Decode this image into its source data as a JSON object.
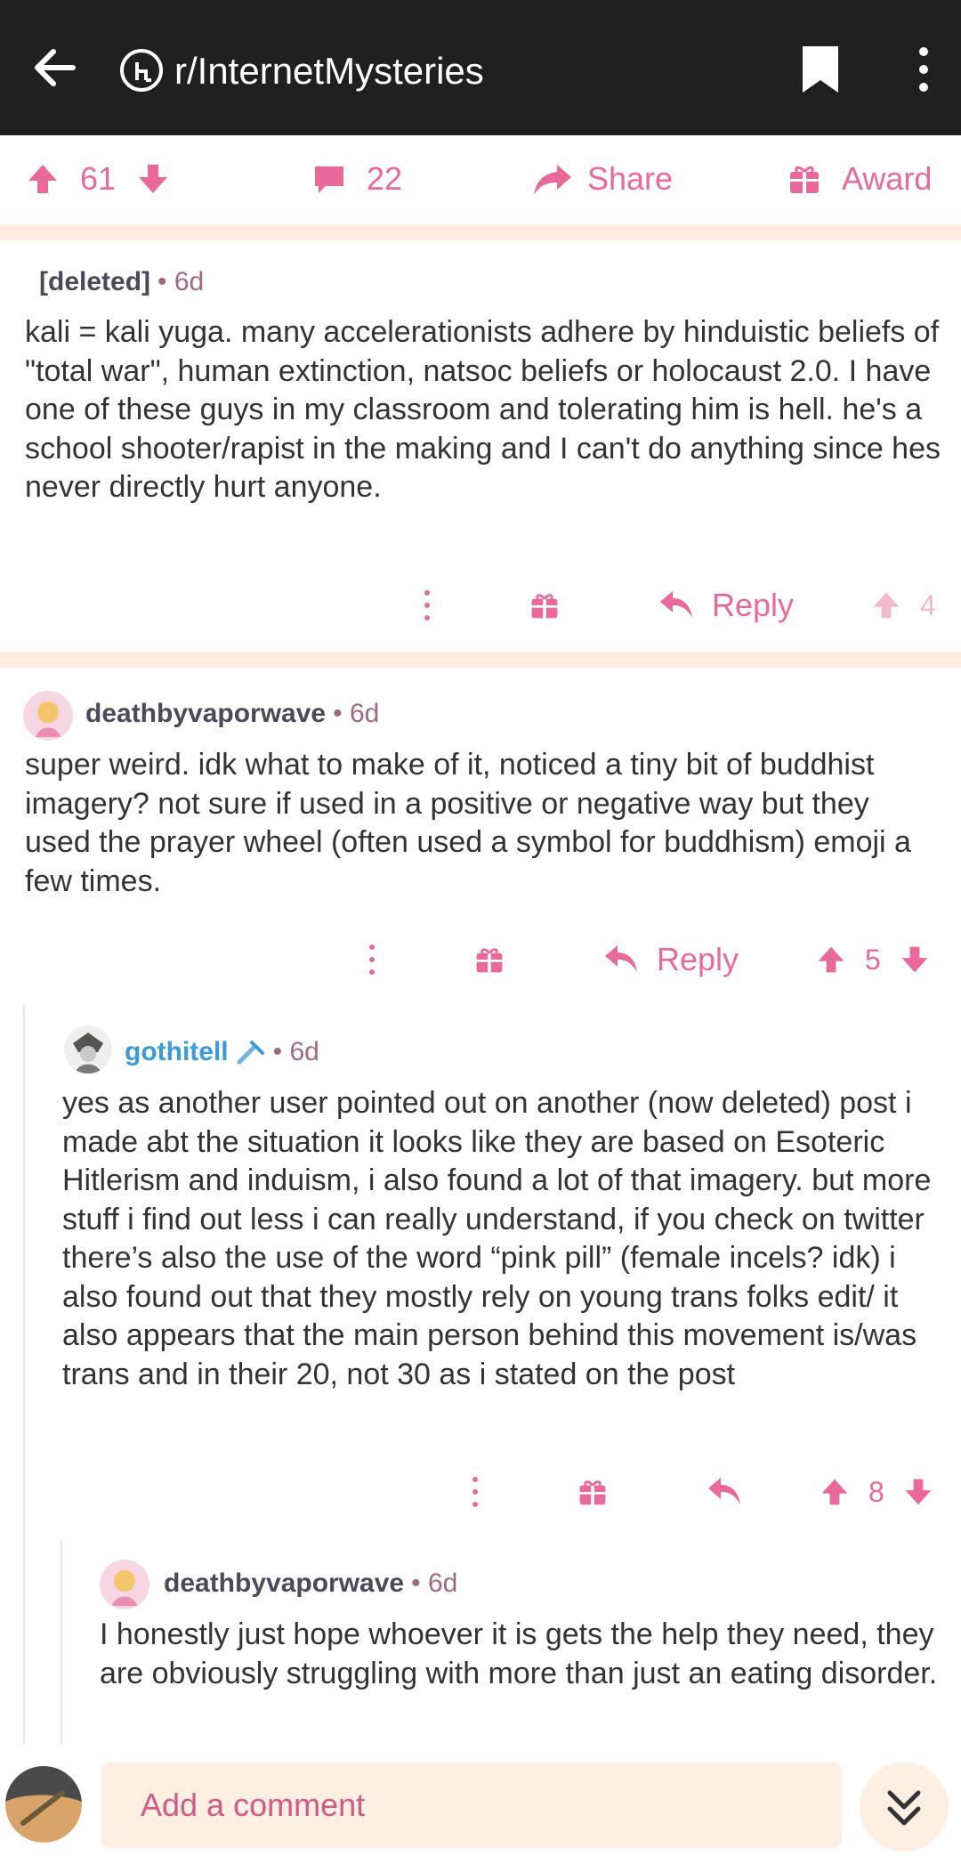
{
  "header": {
    "subreddit": "r/InternetMysteries"
  },
  "post_actions": {
    "upvotes": "61",
    "comments": "22",
    "share": "Share",
    "award": "Award"
  },
  "comments": [
    {
      "author": "[deleted]",
      "time": "6d",
      "body": "kali = kali yuga. many accelerationists adhere by hinduistic beliefs of \"total war\", human extinction, natsoc beliefs or holocaust 2.0. I have one of these guys in my classroom and tolerating him is hell. he's a school shooter/rapist in the making and I can't do anything since hes never directly hurt anyone.",
      "reply_label": "Reply",
      "votes": "4"
    },
    {
      "author": "deathbyvaporwave",
      "time": "6d",
      "body": "super weird. idk what to make of it, noticed a tiny bit of buddhist imagery? not sure if used in a positive or negative way but they used the prayer wheel (often used a symbol for buddhism) emoji a few times.",
      "reply_label": "Reply",
      "votes": "5"
    },
    {
      "author": "gothitell",
      "time": "6d",
      "body": "yes as another user pointed out on another (now deleted) post i made abt the situation it looks like they are based on Esoteric Hitlerism and induism, i also found a lot of that imagery. but more stuff i find out less i can really understand, if you check on twitter there’s also the use of the word “pink pill” (female incels? idk) i also found out that they mostly rely on young trans folks edit/ it also appears that the main person behind this movement is/was trans and in their 20, not 30 as i stated on the post",
      "votes": "8"
    },
    {
      "author": "deathbyvaporwave",
      "time": "6d",
      "body": "I honestly just hope whoever it is gets the help they need, they are obviously struggling with more than just an eating disorder."
    }
  ],
  "composer": {
    "placeholder": "Add a comment"
  },
  "colors": {
    "accent": "#e96a9a",
    "topbar": "#202020",
    "separator": "#fdecdf",
    "input_bg": "#fdf0e2"
  }
}
